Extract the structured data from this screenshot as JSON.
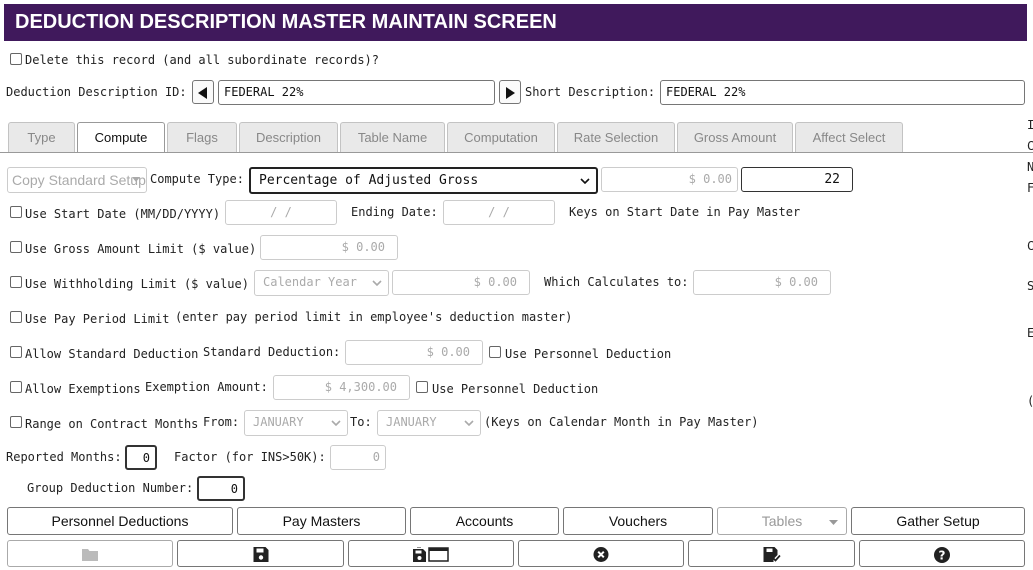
{
  "title": "DEDUCTION DESCRIPTION MASTER MAINTAIN SCREEN",
  "delete_record": {
    "label": "Delete this record (and all subordinate records)?",
    "checked": false
  },
  "id_row": {
    "id_label": "Deduction Description ID:",
    "id_value": "FEDERAL 22%",
    "short_label": "Short Description:",
    "short_value": "FEDERAL 22%"
  },
  "tabs": [
    {
      "label": "Type",
      "active": false
    },
    {
      "label": "Compute",
      "active": true
    },
    {
      "label": "Flags",
      "active": false
    },
    {
      "label": "Description",
      "active": false
    },
    {
      "label": "Table Name",
      "active": false
    },
    {
      "label": "Computation",
      "active": false
    },
    {
      "label": "Rate Selection",
      "active": false
    },
    {
      "label": "Gross Amount",
      "active": false
    },
    {
      "label": "Affect Select",
      "active": false
    }
  ],
  "compute": {
    "copy_setup": "Copy Standard Setup",
    "type_label": "Compute Type:",
    "type_value": "Percentage of Adjusted Gross",
    "amount_value": "$ 0.00",
    "percent_value": "22",
    "start_date_label": "Use Start Date (MM/DD/YYYY)",
    "start_date_value": " /  / ",
    "ending_label": "Ending Date:",
    "ending_value": " /  / ",
    "keys_start": "Keys on Start Date in Pay Master",
    "gross_limit_label": "Use Gross Amount Limit ($ value)",
    "gross_limit_value": "$ 0.00",
    "withholding_label": "Use Withholding Limit ($ value)",
    "withholding_period": "Calendar Year",
    "withholding_value": "$ 0.00",
    "calculates_label": "Which Calculates to:",
    "calculates_value": "$ 0.00",
    "pay_period_label": "Use Pay Period Limit",
    "pay_period_note": "(enter pay period limit in employee's deduction master)",
    "std_ded_label": "Allow Standard Deduction",
    "std_ded_amount_label": "Standard Deduction:",
    "std_ded_value": "$ 0.00",
    "use_personnel_1": "Use Personnel Deduction",
    "exemptions_label": "Allow Exemptions",
    "exemption_amount_label": "Exemption Amount:",
    "exemption_value": "$ 4,300.00",
    "use_personnel_2": "Use Personnel Deduction",
    "range_label": "Range on Contract Months",
    "from_label": "From:",
    "from_value": "JANUARY",
    "to_label": "To:",
    "to_value": "JANUARY",
    "keys_month": "(Keys on Calendar Month in Pay Master)",
    "reported_label": "Reported Months:",
    "reported_value": "0",
    "factor_label": "Factor (for INS>50K):",
    "factor_value": "0",
    "group_label": "Group Deduction Number:",
    "group_value": "0"
  },
  "bottom_buttons": {
    "personnel": "Personnel Deductions",
    "pay_masters": "Pay Masters",
    "accounts": "Accounts",
    "vouchers": "Vouchers",
    "tables": "Tables",
    "gather": "Gather Setup"
  },
  "right_edge_chars": [
    "I",
    "C",
    "N",
    "F",
    "C",
    "S",
    "E",
    "("
  ],
  "icons": [
    "folder-icon",
    "save-icon",
    "save-as-icon",
    "cancel-icon",
    "save-check-icon",
    "help-icon"
  ],
  "colors": {
    "title_bg": "#40195c",
    "title_text": "#ffffff"
  }
}
